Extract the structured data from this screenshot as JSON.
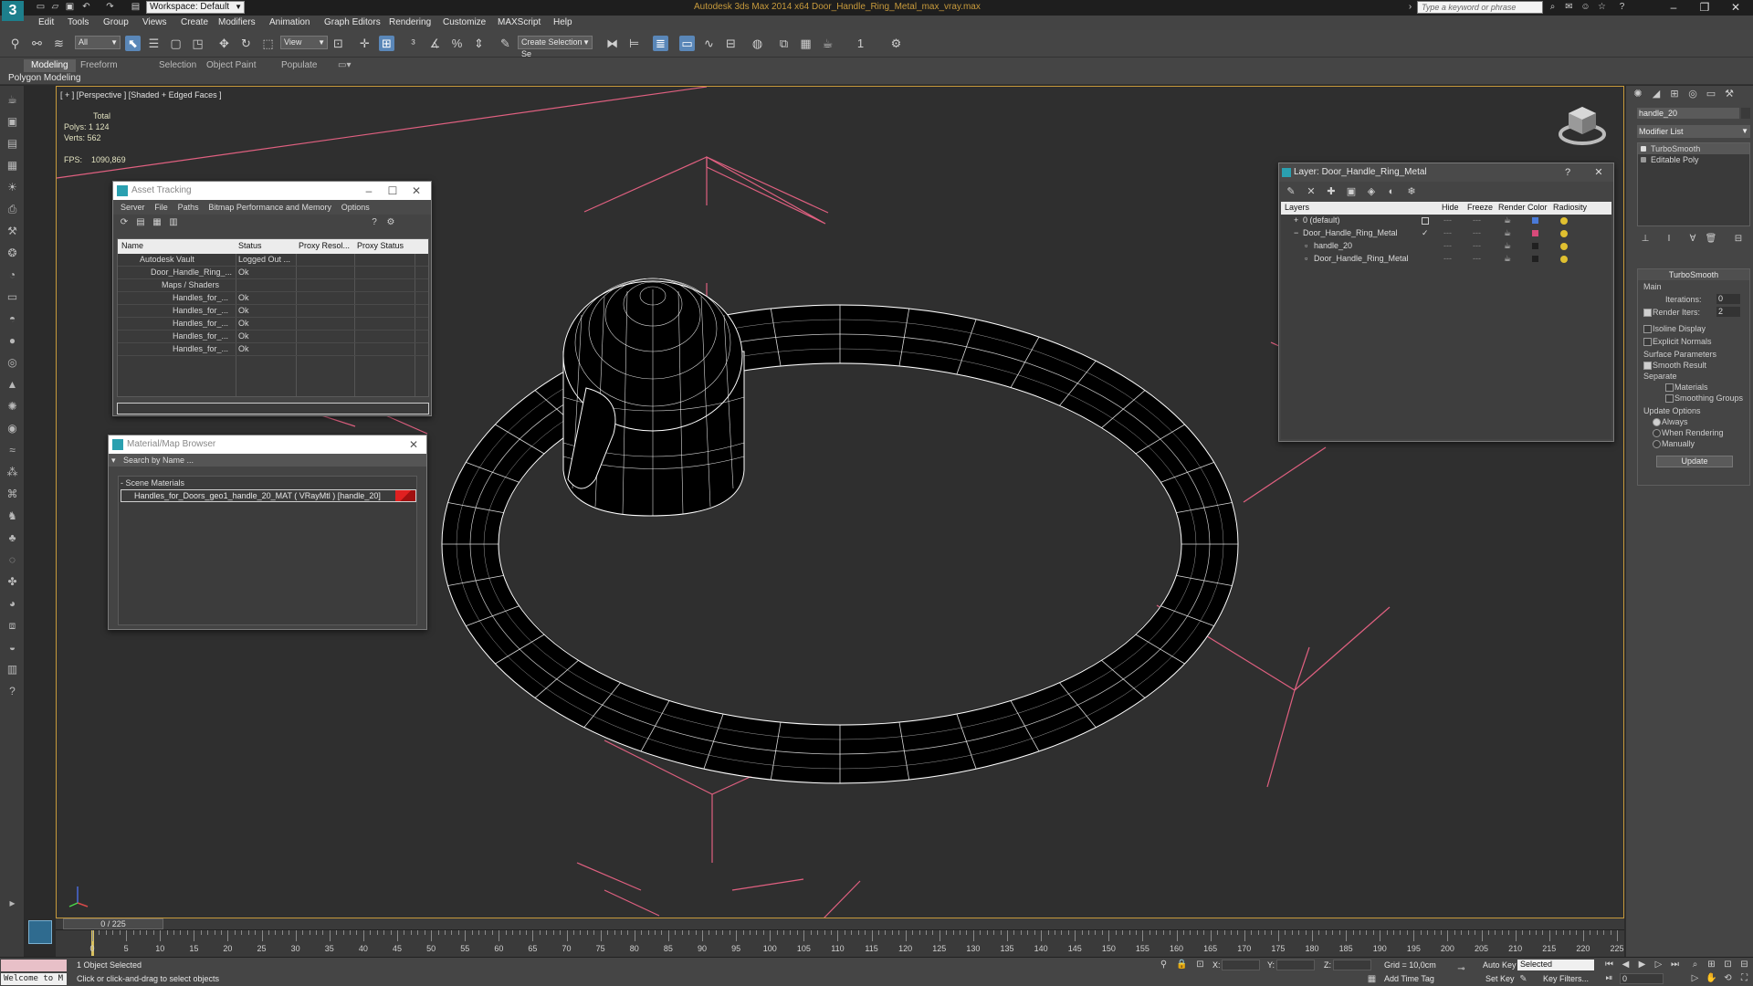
{
  "app": {
    "title": "Autodesk 3ds Max 2014 x64      Door_Handle_Ring_Metal_max_vray.max",
    "workspace": "Workspace: Default",
    "search_placeholder": "Type a keyword or phrase"
  },
  "menu": [
    "Edit",
    "Tools",
    "Group",
    "Views",
    "Create",
    "Modifiers",
    "Animation",
    "Graph Editors",
    "Rendering",
    "Customize",
    "MAXScript",
    "Help"
  ],
  "toolbar": {
    "filter_all": "All",
    "ref_coord": "View",
    "selection_set": "Create Selection Se",
    "snap_value": "1"
  },
  "ribbon": {
    "tabs": [
      "Modeling",
      "Freeform",
      "Selection",
      "Object Paint",
      "Populate"
    ],
    "active_tab": "Modeling",
    "sub_label": "Polygon Modeling"
  },
  "viewport": {
    "label": "[ + ] [Perspective ] [Shaded + Edged Faces ]",
    "stats_total": "Total",
    "polys_label": "Polys:",
    "polys": "1 124",
    "verts_label": "Verts:",
    "verts": "562",
    "fps_label": "FPS:",
    "fps": "1090,869",
    "colors": {
      "wire": "#ffffff",
      "mesh": "#000000",
      "gizmo": "#e06080",
      "border": "#c79a3c"
    }
  },
  "asset_tracking": {
    "title": "Asset Tracking",
    "menu": [
      "Server",
      "File",
      "Paths",
      "Bitmap Performance and Memory",
      "Options"
    ],
    "columns": [
      "Name",
      "Status",
      "Proxy Resol...",
      "Proxy Status"
    ],
    "rows": [
      {
        "name": "Autodesk Vault",
        "status": "Logged Out ..."
      },
      {
        "name": "Door_Handle_Ring_...",
        "status": "Ok"
      },
      {
        "name": "Maps / Shaders",
        "status": ""
      },
      {
        "name": "Handles_for_...",
        "status": "Ok"
      },
      {
        "name": "Handles_for_...",
        "status": "Ok"
      },
      {
        "name": "Handles_for_...",
        "status": "Ok"
      },
      {
        "name": "Handles_for_...",
        "status": "Ok"
      },
      {
        "name": "Handles_for_...",
        "status": "Ok"
      }
    ]
  },
  "material_browser": {
    "title": "Material/Map Browser",
    "search_placeholder": "Search by Name ...",
    "group": "- Scene Materials",
    "item": "Handles_for_Doors_geo1_handle_20_MAT ( VRayMtl ) [handle_20]"
  },
  "layer_manager": {
    "title": "Layer: Door_Handle_Ring_Metal",
    "help": "?",
    "columns": [
      "Layers",
      "Hide",
      "Freeze",
      "Render",
      "Color",
      "Radiosity"
    ],
    "rows": [
      {
        "name": "0 (default)",
        "color": "#4a7ad8"
      },
      {
        "name": "Door_Handle_Ring_Metal",
        "color": "#d84a7a"
      },
      {
        "name": "handle_20",
        "color": "#202020"
      },
      {
        "name": "Door_Handle_Ring_Metal",
        "color": "#202020"
      }
    ],
    "dash": "---"
  },
  "command_panel": {
    "object_name": "handle_20",
    "modifier_list": "Modifier List",
    "stack": [
      "TurboSmooth",
      "Editable Poly"
    ],
    "turbosmooth": {
      "title": "TurboSmooth",
      "main": "Main",
      "iterations_label": "Iterations:",
      "iterations": "0",
      "render_iters_label": "Render Iters:",
      "render_iters": "2",
      "isoline": "Isoline Display",
      "explicit_normals": "Explicit Normals",
      "surface_params": "Surface Parameters",
      "smooth_result": "Smooth Result",
      "separate": "Separate",
      "materials": "Materials",
      "smoothing_groups": "Smoothing Groups",
      "update_options": "Update Options",
      "always": "Always",
      "when_rendering": "When Rendering",
      "manually": "Manually",
      "update_button": "Update"
    }
  },
  "timeline": {
    "frame": "0 / 225",
    "ticks": [
      0,
      5,
      10,
      15,
      20,
      25,
      30,
      35,
      40,
      45,
      50,
      55,
      60,
      65,
      70,
      75,
      80,
      85,
      90,
      95,
      100,
      105,
      110,
      115,
      120,
      125,
      130,
      135,
      140,
      145,
      150,
      155,
      160,
      165,
      170,
      175,
      180,
      185,
      190,
      195,
      200,
      205,
      210,
      215,
      220,
      225
    ]
  },
  "status": {
    "maxscript": "Welcome to M",
    "selected": "1 Object Selected",
    "prompt": "Click or click-and-drag to select objects",
    "x_label": "X:",
    "y_label": "Y:",
    "z_label": "Z:",
    "grid": "Grid = 10,0cm",
    "add_time_tag": "Add Time Tag",
    "auto_key": "Auto Key",
    "set_key": "Set Key",
    "key_mode": "Selected",
    "key_filters": "Key Filters...",
    "frame_value": "0"
  }
}
